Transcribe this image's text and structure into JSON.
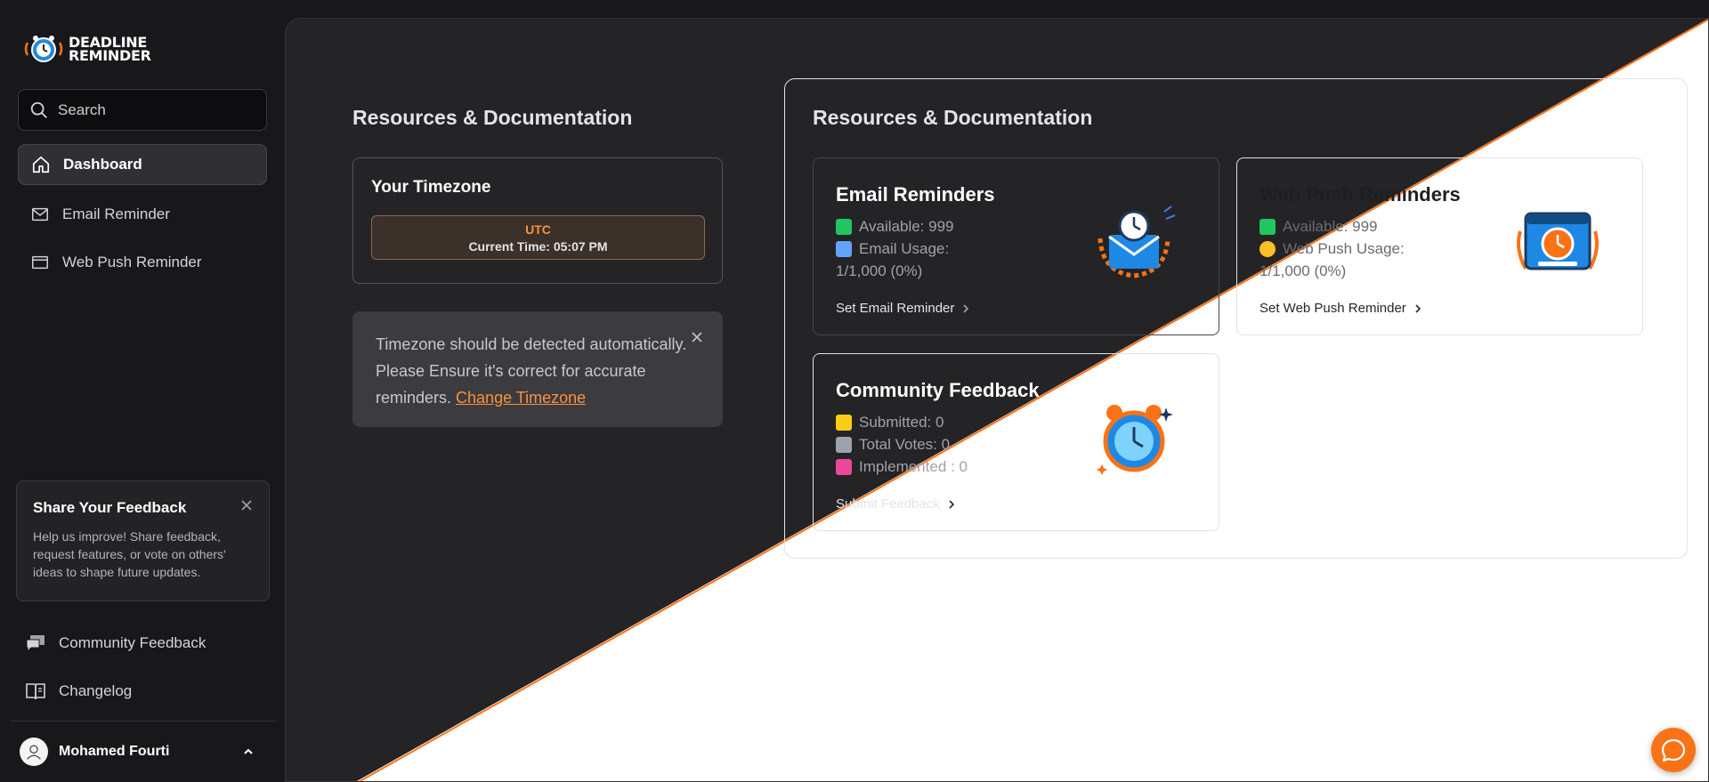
{
  "app": {
    "logo_line1": "DEADLINE",
    "logo_line2": "REMINDER"
  },
  "search": {
    "placeholder": "Search"
  },
  "nav": {
    "dashboard": "Dashboard",
    "email_reminder": "Email Reminder",
    "web_push_reminder": "Web Push Reminder",
    "community_feedback": "Community Feedback",
    "changelog": "Changelog"
  },
  "feedback_card": {
    "title": "Share Your Feedback",
    "body": "Help us improve! Share feedback, request features, or vote on others' ideas to shape future updates."
  },
  "user": {
    "name": "Mohamed Fourti"
  },
  "left_section": {
    "title": "Resources & Documentation",
    "timezone_card": {
      "title": "Your Timezone",
      "zone": "UTC",
      "current_time": "Current Time: 05:07 PM"
    },
    "alert": {
      "text": "Timezone should be detected automatically. Please Ensure it's correct for accurate reminders. ",
      "link": "Change Timezone"
    }
  },
  "right_section": {
    "title": "Resources & Documentation",
    "email": {
      "title": "Email Reminders",
      "available": "Available: 999",
      "usage_label": "Email Usage:",
      "usage_value": "1/1,000 (0%)",
      "action": "Set Email Reminder"
    },
    "webpush": {
      "title": "Web Push Reminders",
      "available": "Available: 999",
      "usage_label": "Web Push Usage:",
      "usage_value": "1/1,000 (0%)",
      "action": "Set Web Push Reminder"
    },
    "community": {
      "title": "Community Feedback",
      "submitted": "Submitted: 0",
      "total_votes": "Total Votes: 0",
      "implemented": "Implemented : 0",
      "action": "Submit Feedback"
    }
  },
  "colors": {
    "accent": "#f97316",
    "sidebar_bg": "#18181b",
    "panel_dark": "#242426",
    "panel_light": "#ffffff"
  }
}
